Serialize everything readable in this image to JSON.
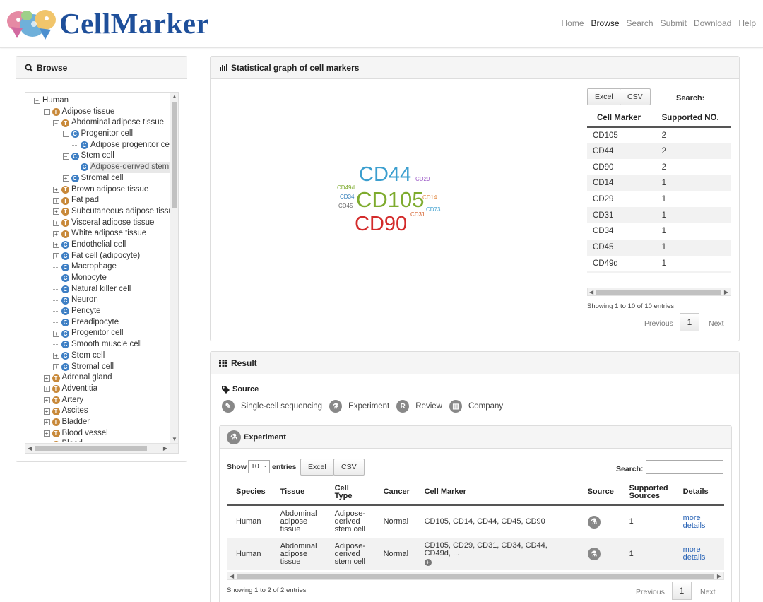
{
  "header": {
    "logo_text": "CellMarker",
    "nav": [
      "Home",
      "Browse",
      "Search",
      "Submit",
      "Download",
      "Help"
    ],
    "active_nav": "Browse"
  },
  "browse": {
    "title": "Browse",
    "tree": [
      {
        "label": "Human",
        "depth": 0,
        "toggle": "-",
        "icon": ""
      },
      {
        "label": "Adipose tissue",
        "depth": 1,
        "toggle": "-",
        "icon": "t"
      },
      {
        "label": "Abdominal adipose tissue",
        "depth": 2,
        "toggle": "-",
        "icon": "t"
      },
      {
        "label": "Progenitor cell",
        "depth": 3,
        "toggle": "-",
        "icon": "c"
      },
      {
        "label": "Adipose progenitor cel",
        "depth": 4,
        "toggle": "",
        "icon": "c"
      },
      {
        "label": "Stem cell",
        "depth": 3,
        "toggle": "-",
        "icon": "c"
      },
      {
        "label": "Adipose-derived stem c",
        "depth": 4,
        "toggle": "",
        "icon": "c",
        "selected": true
      },
      {
        "label": "Stromal cell",
        "depth": 3,
        "toggle": "+",
        "icon": "c"
      },
      {
        "label": "Brown adipose tissue",
        "depth": 2,
        "toggle": "+",
        "icon": "t"
      },
      {
        "label": "Fat pad",
        "depth": 2,
        "toggle": "+",
        "icon": "t"
      },
      {
        "label": "Subcutaneous adipose tissue",
        "depth": 2,
        "toggle": "+",
        "icon": "t"
      },
      {
        "label": "Visceral adipose tissue",
        "depth": 2,
        "toggle": "+",
        "icon": "t"
      },
      {
        "label": "White adipose tissue",
        "depth": 2,
        "toggle": "+",
        "icon": "t"
      },
      {
        "label": "Endothelial cell",
        "depth": 2,
        "toggle": "+",
        "icon": "c"
      },
      {
        "label": "Fat cell (adipocyte)",
        "depth": 2,
        "toggle": "+",
        "icon": "c"
      },
      {
        "label": "Macrophage",
        "depth": 2,
        "toggle": "",
        "icon": "c"
      },
      {
        "label": "Monocyte",
        "depth": 2,
        "toggle": "",
        "icon": "c"
      },
      {
        "label": "Natural killer cell",
        "depth": 2,
        "toggle": "",
        "icon": "c"
      },
      {
        "label": "Neuron",
        "depth": 2,
        "toggle": "",
        "icon": "c"
      },
      {
        "label": "Pericyte",
        "depth": 2,
        "toggle": "",
        "icon": "c"
      },
      {
        "label": "Preadipocyte",
        "depth": 2,
        "toggle": "",
        "icon": "c"
      },
      {
        "label": "Progenitor cell",
        "depth": 2,
        "toggle": "+",
        "icon": "c"
      },
      {
        "label": "Smooth muscle cell",
        "depth": 2,
        "toggle": "",
        "icon": "c"
      },
      {
        "label": "Stem cell",
        "depth": 2,
        "toggle": "+",
        "icon": "c"
      },
      {
        "label": "Stromal cell",
        "depth": 2,
        "toggle": "+",
        "icon": "c"
      },
      {
        "label": "Adrenal gland",
        "depth": 1,
        "toggle": "+",
        "icon": "t"
      },
      {
        "label": "Adventitia",
        "depth": 1,
        "toggle": "+",
        "icon": "t"
      },
      {
        "label": "Artery",
        "depth": 1,
        "toggle": "+",
        "icon": "t"
      },
      {
        "label": "Ascites",
        "depth": 1,
        "toggle": "+",
        "icon": "t"
      },
      {
        "label": "Bladder",
        "depth": 1,
        "toggle": "+",
        "icon": "t"
      },
      {
        "label": "Blood vessel",
        "depth": 1,
        "toggle": "+",
        "icon": "t"
      },
      {
        "label": "Blood",
        "depth": 1,
        "toggle": "+",
        "icon": "t"
      }
    ]
  },
  "stats": {
    "title": "Statistical graph of cell markers",
    "cloud": [
      {
        "text": "CD44",
        "color": "#3c9fcf",
        "weight": 2
      },
      {
        "text": "CD105",
        "color": "#7eab2e",
        "weight": 2
      },
      {
        "text": "CD90",
        "color": "#d32b2b",
        "weight": 2
      },
      {
        "text": "CD29",
        "color": "#9b59c6",
        "weight": 1
      },
      {
        "text": "CD49d",
        "color": "#7eab2e",
        "weight": 1
      },
      {
        "text": "CD34",
        "color": "#2b7ab8",
        "weight": 1
      },
      {
        "text": "CD45",
        "color": "#666666",
        "weight": 1
      },
      {
        "text": "CD14",
        "color": "#e0843a",
        "weight": 1
      },
      {
        "text": "CD31",
        "color": "#d3602b",
        "weight": 1
      },
      {
        "text": "CD73",
        "color": "#3c9fcf",
        "weight": 1
      }
    ],
    "btn_excel": "Excel",
    "btn_csv": "CSV",
    "search_label": "Search:",
    "columns": [
      "Cell Marker",
      "Supported NO."
    ],
    "rows": [
      [
        "CD105",
        "2"
      ],
      [
        "CD44",
        "2"
      ],
      [
        "CD90",
        "2"
      ],
      [
        "CD14",
        "1"
      ],
      [
        "CD29",
        "1"
      ],
      [
        "CD31",
        "1"
      ],
      [
        "CD34",
        "1"
      ],
      [
        "CD45",
        "1"
      ],
      [
        "CD49d",
        "1"
      ],
      [
        "CD73",
        "1"
      ]
    ],
    "info": "Showing 1 to 10 of 10 entries",
    "previous": "Previous",
    "page": "1",
    "next": "Next"
  },
  "result": {
    "title": "Result",
    "source_label": "Source",
    "legend": [
      {
        "label": "Single-cell sequencing",
        "icon": "single-cell-sequencing-icon",
        "glyph": "✎"
      },
      {
        "label": "Experiment",
        "icon": "experiment-icon",
        "glyph": "⚗"
      },
      {
        "label": "Review",
        "icon": "review-icon",
        "glyph": "R"
      },
      {
        "label": "Company",
        "icon": "company-icon",
        "glyph": "▥"
      }
    ],
    "experiment": {
      "title": "Experiment",
      "show_label": "Show",
      "show_value": "10",
      "entries_label": "entries",
      "btn_excel": "Excel",
      "btn_csv": "CSV",
      "search_label": "Search:",
      "columns": [
        "Species",
        "Tissue",
        "Cell Type",
        "Cancer",
        "Cell Marker",
        "Source",
        "Supported Sources",
        "Details"
      ],
      "rows": [
        {
          "species": "Human",
          "tissue": "Abdominal adipose tissue",
          "cell_type": "Adipose-derived stem cell",
          "cancer": "Normal",
          "markers": "CD105, CD14, CD44, CD45, CD90",
          "supported": "1",
          "details": "more details"
        },
        {
          "species": "Human",
          "tissue": "Abdominal adipose tissue",
          "cell_type": "Adipose-derived stem cell",
          "cancer": "Normal",
          "markers": "CD105, CD29, CD31, CD34, CD44, CD49d, ...",
          "supported": "1",
          "details": "more details"
        }
      ],
      "info": "Showing 1 to 2 of 2 entries",
      "previous": "Previous",
      "page": "1",
      "next": "Next"
    }
  }
}
